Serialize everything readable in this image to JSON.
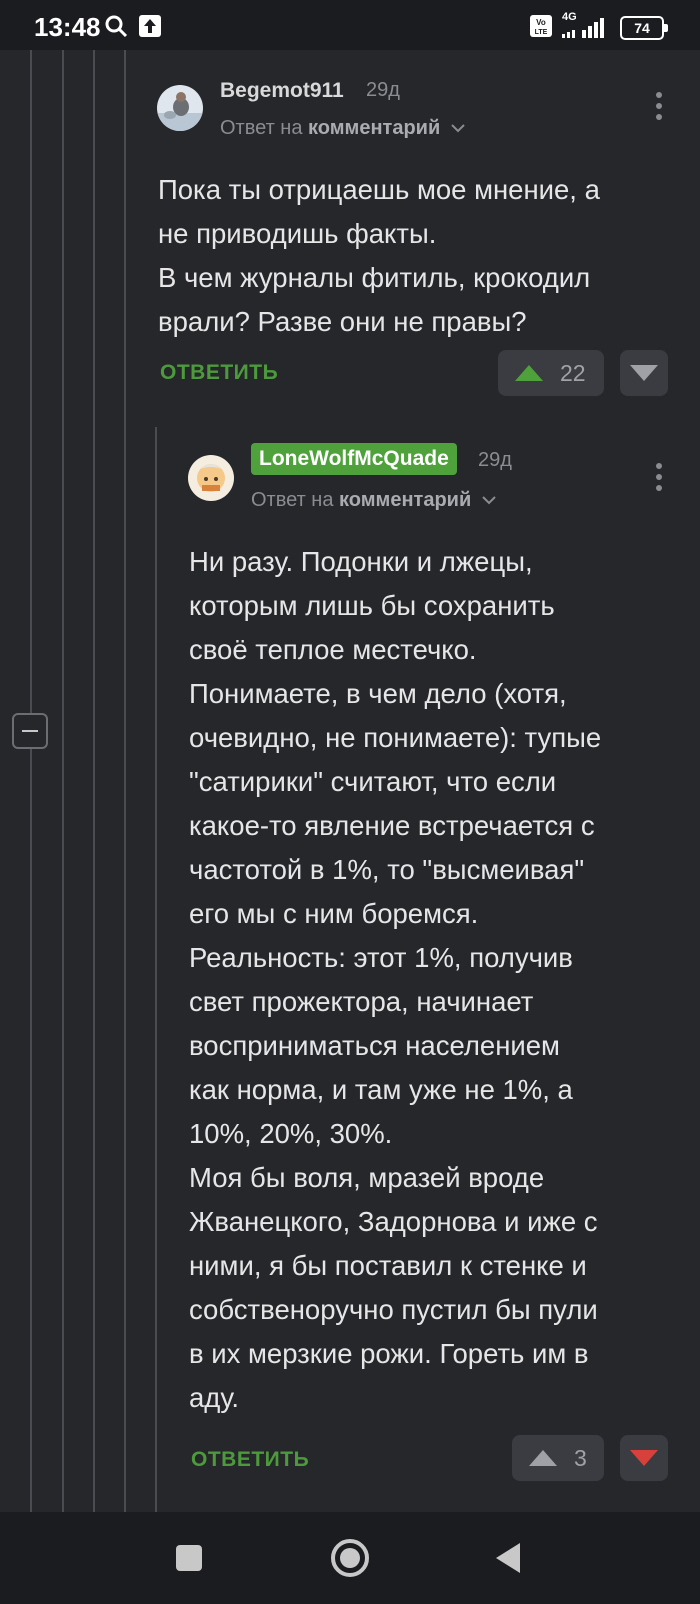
{
  "status": {
    "time": "13:48",
    "battery": "74",
    "network": "4G"
  },
  "comments": [
    {
      "username": "Begemot911",
      "age": "29д",
      "reply_prefix": "Ответ на",
      "reply_target": "комментарий",
      "text": "Пока ты отрицаешь мое мнение, а\nне приводишь факты.\nВ чем журналы фитиль, крокодил\nврали? Разве они не правы?",
      "reply_label": "ОТВЕТИТЬ",
      "rating": "22"
    },
    {
      "username": "LoneWolfMcQuade",
      "age": "29д",
      "reply_prefix": "Ответ на",
      "reply_target": "комментарий",
      "text": "Ни разу. Подонки и лжецы,\nкоторым лишь бы сохранить\nсвоё теплое местечко.\nПонимаете, в чем дело (хотя,\nочевидно, не понимаете): тупые\n\"сатирики\" считают, что если\nкакое-то явление встречается с\nчастотой в 1%, то \"высмеивая\"\nего мы с ним боремся.\nРеальность: этот 1%, получив\nсвет прожектора, начинает\nвосприниматься населением\nкак норма, и там уже не 1%, а\n10%, 20%, 30%.\nМоя бы воля, мразей вроде\nЖванецкого, Задорнова и иже с\nними, я бы поставил к стенке и\nсобственоручно пустил бы пули\nв их мерзкие рожи. Гореть им в\nаду.",
      "reply_label": "ОТВЕТИТЬ",
      "rating": "3"
    }
  ],
  "colors": {
    "background": "#25272b",
    "accent_green": "#4fa13c",
    "upvote_active": "#4fa13c",
    "downvote_active": "#d8413b"
  },
  "icons": [
    "search-icon",
    "upload-icon",
    "volte-icon",
    "signal-icon",
    "battery-icon",
    "more-vert-icon",
    "upvote-icon",
    "downvote-icon",
    "collapse-icon",
    "nav-recents-icon",
    "nav-home-icon",
    "nav-back-icon"
  ]
}
